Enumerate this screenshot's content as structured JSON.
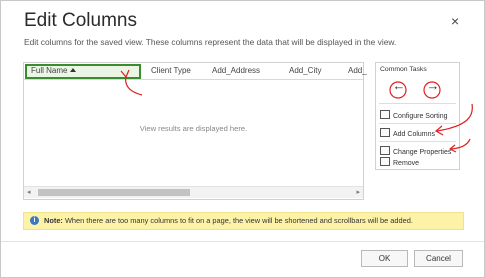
{
  "dialog": {
    "title": "Edit Columns",
    "close_glyph": "×",
    "subtitle": "Edit columns for the saved view. These columns represent the data that will be displayed in the view."
  },
  "grid": {
    "columns": [
      "Full Name",
      "Client Type",
      "Add_Address",
      "Add_City",
      "Add_"
    ],
    "sorted_column": "Full Name",
    "sort_direction": "ascending",
    "empty_message": "View results are displayed here."
  },
  "scrollbar": {
    "left_glyph": "◂",
    "right_glyph": "▸"
  },
  "common_tasks": {
    "title": "Common Tasks",
    "nav_left": "←",
    "nav_right": "→",
    "items": [
      {
        "label": "Configure Sorting",
        "icon": "sort-icon"
      },
      {
        "label": "Add Columns",
        "icon": "add-columns-icon"
      },
      {
        "label": "Change Properties",
        "icon": "properties-icon"
      },
      {
        "label": "Remove",
        "icon": "remove-icon"
      }
    ]
  },
  "note": {
    "icon_glyph": "i",
    "label": "Note:",
    "text": " When there are too many columns to fit on a page, the view will be shortened and scrollbars will be added."
  },
  "buttons": {
    "ok": "OK",
    "cancel": "Cancel"
  },
  "colors": {
    "selection_border": "#3a8c2e",
    "annotation": "#e02020",
    "note_bg": "#fdf3a8"
  }
}
